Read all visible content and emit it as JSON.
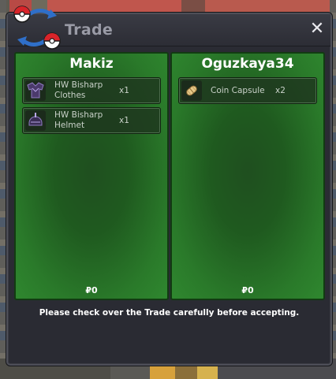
{
  "window": {
    "title": "Trade",
    "close_label": "✕"
  },
  "left_panel": {
    "player_name": "Makiz",
    "items": [
      {
        "name": "HW Bisharp Clothes",
        "qty": "x1",
        "icon": "clothes-icon"
      },
      {
        "name": "HW Bisharp Helmet",
        "qty": "x1",
        "icon": "helmet-icon"
      }
    ],
    "money": "₽0"
  },
  "right_panel": {
    "player_name": "Oguzkaya34",
    "items": [
      {
        "name": "Coin Capsule",
        "qty": "x2",
        "icon": "coin-capsule-icon"
      }
    ],
    "money": "₽0"
  },
  "notice": "Please check over the Trade carefully before accepting.",
  "colors": {
    "panel_green": "#2a7a2a",
    "window_bg": "#2a2b33",
    "title_text": "#9a9ba6"
  }
}
